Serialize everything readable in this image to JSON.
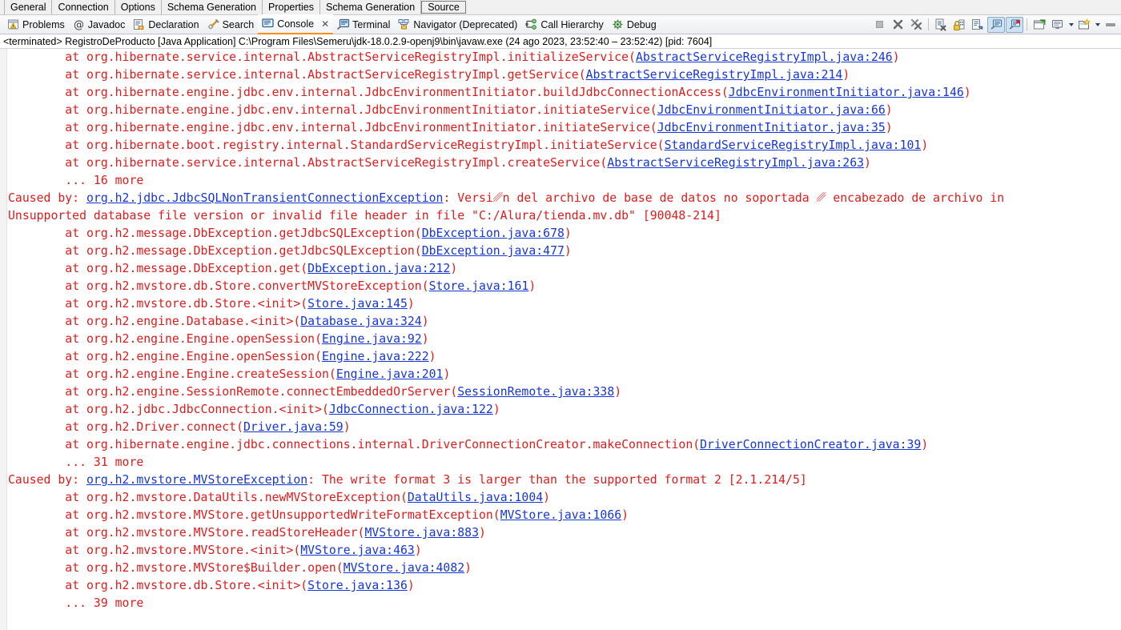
{
  "property_tabs": [
    {
      "label": "General",
      "selected": false
    },
    {
      "label": "Connection",
      "selected": false
    },
    {
      "label": "Options",
      "selected": false
    },
    {
      "label": "Schema Generation",
      "selected": false
    },
    {
      "label": "Properties",
      "selected": false
    },
    {
      "label": "Schema Generation",
      "selected": false
    },
    {
      "label": "Source",
      "selected": true
    }
  ],
  "view_tabs": [
    {
      "label": "Problems",
      "icon": "problems-icon",
      "active": false,
      "closable": false
    },
    {
      "label": "Javadoc",
      "icon": "javadoc-icon",
      "active": false,
      "closable": false
    },
    {
      "label": "Declaration",
      "icon": "declaration-icon",
      "active": false,
      "closable": false
    },
    {
      "label": "Search",
      "icon": "search-icon",
      "active": false,
      "closable": false
    },
    {
      "label": "Console",
      "icon": "console-icon",
      "active": true,
      "closable": true,
      "close_label": "✕"
    },
    {
      "label": "Terminal",
      "icon": "terminal-icon",
      "active": false,
      "closable": false
    },
    {
      "label": "Navigator (Deprecated)",
      "icon": "navigator-icon",
      "active": false,
      "closable": false
    },
    {
      "label": "Call Hierarchy",
      "icon": "call-hierarchy-icon",
      "active": false,
      "closable": false
    },
    {
      "label": "Debug",
      "icon": "debug-icon",
      "active": false,
      "closable": false
    }
  ],
  "toolbar": {
    "buttons": [
      {
        "name": "terminate-button",
        "tooltip": "Terminate",
        "state": "disabled"
      },
      {
        "name": "remove-launch-button",
        "tooltip": "Remove Launch",
        "state": "normal"
      },
      {
        "name": "remove-all-terminated-button",
        "tooltip": "Remove All Terminated Launches",
        "state": "normal"
      },
      {
        "name": "clear-console-button",
        "tooltip": "Clear Console",
        "state": "normal"
      },
      {
        "name": "scroll-lock-button",
        "tooltip": "Scroll Lock",
        "state": "normal"
      },
      {
        "name": "word-wrap-button",
        "tooltip": "Word Wrap",
        "state": "normal"
      },
      {
        "name": "show-console-on-output-button",
        "tooltip": "Show Console When Standard Out Changes",
        "state": "pressed"
      },
      {
        "name": "show-console-on-error-button",
        "tooltip": "Show Console When Standard Error Changes",
        "state": "pressed"
      },
      {
        "name": "pin-console-button",
        "tooltip": "Pin Console",
        "state": "normal"
      },
      {
        "name": "display-selected-console-button",
        "tooltip": "Display Selected Console",
        "state": "normal"
      },
      {
        "name": "open-console-button",
        "tooltip": "Open Console",
        "state": "normal"
      },
      {
        "name": "view-menu-button",
        "tooltip": "View Menu",
        "state": "normal"
      }
    ]
  },
  "process_header": "<terminated> RegistroDeProducto [Java Application] C:\\Program Files\\Semeru\\jdk-18.0.2.9-openj9\\bin\\javaw.exe  (24 ago 2023, 23:52:40 – 23:52:42) [pid: 7604]",
  "colors": {
    "error_text": "#e01b1b",
    "link": "#1636d8",
    "tab_accent": "#ff8c1a",
    "toolbar_pressed": "#cde2f5"
  },
  "console_lines": [
    {
      "indent": 8,
      "prefix": "at org.hibernate.service.internal.AbstractServiceRegistryImpl.initializeService(",
      "link": "AbstractServiceRegistryImpl.java:246",
      "suffix": ")"
    },
    {
      "indent": 8,
      "prefix": "at org.hibernate.service.internal.AbstractServiceRegistryImpl.getService(",
      "link": "AbstractServiceRegistryImpl.java:214",
      "suffix": ")"
    },
    {
      "indent": 8,
      "prefix": "at org.hibernate.engine.jdbc.env.internal.JdbcEnvironmentInitiator.buildJdbcConnectionAccess(",
      "link": "JdbcEnvironmentInitiator.java:146",
      "suffix": ")"
    },
    {
      "indent": 8,
      "prefix": "at org.hibernate.engine.jdbc.env.internal.JdbcEnvironmentInitiator.initiateService(",
      "link": "JdbcEnvironmentInitiator.java:66",
      "suffix": ")"
    },
    {
      "indent": 8,
      "prefix": "at org.hibernate.engine.jdbc.env.internal.JdbcEnvironmentInitiator.initiateService(",
      "link": "JdbcEnvironmentInitiator.java:35",
      "suffix": ")"
    },
    {
      "indent": 8,
      "prefix": "at org.hibernate.boot.registry.internal.StandardServiceRegistryImpl.initiateService(",
      "link": "StandardServiceRegistryImpl.java:101",
      "suffix": ")"
    },
    {
      "indent": 8,
      "prefix": "at org.hibernate.service.internal.AbstractServiceRegistryImpl.createService(",
      "link": "AbstractServiceRegistryImpl.java:263",
      "suffix": ")"
    },
    {
      "indent": 8,
      "prefix": "... 16 more",
      "link": "",
      "suffix": ""
    },
    {
      "indent": 0,
      "prefix": "Caused by: ",
      "link": "org.h2.jdbc.JdbcSQLNonTransientConnectionException",
      "suffix": ": Versi␥n del archivo de base de datos no soportada ␥ encabezado de archivo in"
    },
    {
      "indent": 0,
      "prefix": "Unsupported database file version or invalid file header in file \"C:/Alura/tienda.mv.db\" [90048-214]",
      "link": "",
      "suffix": ""
    },
    {
      "indent": 8,
      "prefix": "at org.h2.message.DbException.getJdbcSQLException(",
      "link": "DbException.java:678",
      "suffix": ")"
    },
    {
      "indent": 8,
      "prefix": "at org.h2.message.DbException.getJdbcSQLException(",
      "link": "DbException.java:477",
      "suffix": ")"
    },
    {
      "indent": 8,
      "prefix": "at org.h2.message.DbException.get(",
      "link": "DbException.java:212",
      "suffix": ")"
    },
    {
      "indent": 8,
      "prefix": "at org.h2.mvstore.db.Store.convertMVStoreException(",
      "link": "Store.java:161",
      "suffix": ")"
    },
    {
      "indent": 8,
      "prefix": "at org.h2.mvstore.db.Store.<init>(",
      "link": "Store.java:145",
      "suffix": ")"
    },
    {
      "indent": 8,
      "prefix": "at org.h2.engine.Database.<init>(",
      "link": "Database.java:324",
      "suffix": ")"
    },
    {
      "indent": 8,
      "prefix": "at org.h2.engine.Engine.openSession(",
      "link": "Engine.java:92",
      "suffix": ")"
    },
    {
      "indent": 8,
      "prefix": "at org.h2.engine.Engine.openSession(",
      "link": "Engine.java:222",
      "suffix": ")"
    },
    {
      "indent": 8,
      "prefix": "at org.h2.engine.Engine.createSession(",
      "link": "Engine.java:201",
      "suffix": ")"
    },
    {
      "indent": 8,
      "prefix": "at org.h2.engine.SessionRemote.connectEmbeddedOrServer(",
      "link": "SessionRemote.java:338",
      "suffix": ")"
    },
    {
      "indent": 8,
      "prefix": "at org.h2.jdbc.JdbcConnection.<init>(",
      "link": "JdbcConnection.java:122",
      "suffix": ")"
    },
    {
      "indent": 8,
      "prefix": "at org.h2.Driver.connect(",
      "link": "Driver.java:59",
      "suffix": ")"
    },
    {
      "indent": 8,
      "prefix": "at org.hibernate.engine.jdbc.connections.internal.DriverConnectionCreator.makeConnection(",
      "link": "DriverConnectionCreator.java:39",
      "suffix": ")"
    },
    {
      "indent": 8,
      "prefix": "... 31 more",
      "link": "",
      "suffix": ""
    },
    {
      "indent": 0,
      "prefix": "Caused by: ",
      "link": "org.h2.mvstore.MVStoreException",
      "suffix": ": The write format 3 is larger than the supported format 2 [2.1.214/5]"
    },
    {
      "indent": 8,
      "prefix": "at org.h2.mvstore.DataUtils.newMVStoreException(",
      "link": "DataUtils.java:1004",
      "suffix": ")"
    },
    {
      "indent": 8,
      "prefix": "at org.h2.mvstore.MVStore.getUnsupportedWriteFormatException(",
      "link": "MVStore.java:1066",
      "suffix": ")"
    },
    {
      "indent": 8,
      "prefix": "at org.h2.mvstore.MVStore.readStoreHeader(",
      "link": "MVStore.java:883",
      "suffix": ")"
    },
    {
      "indent": 8,
      "prefix": "at org.h2.mvstore.MVStore.<init>(",
      "link": "MVStore.java:463",
      "suffix": ")"
    },
    {
      "indent": 8,
      "prefix": "at org.h2.mvstore.MVStore$Builder.open(",
      "link": "MVStore.java:4082",
      "suffix": ")"
    },
    {
      "indent": 8,
      "prefix": "at org.h2.mvstore.db.Store.<init>(",
      "link": "Store.java:136",
      "suffix": ")"
    },
    {
      "indent": 8,
      "prefix": "... 39 more",
      "link": "",
      "suffix": ""
    }
  ]
}
